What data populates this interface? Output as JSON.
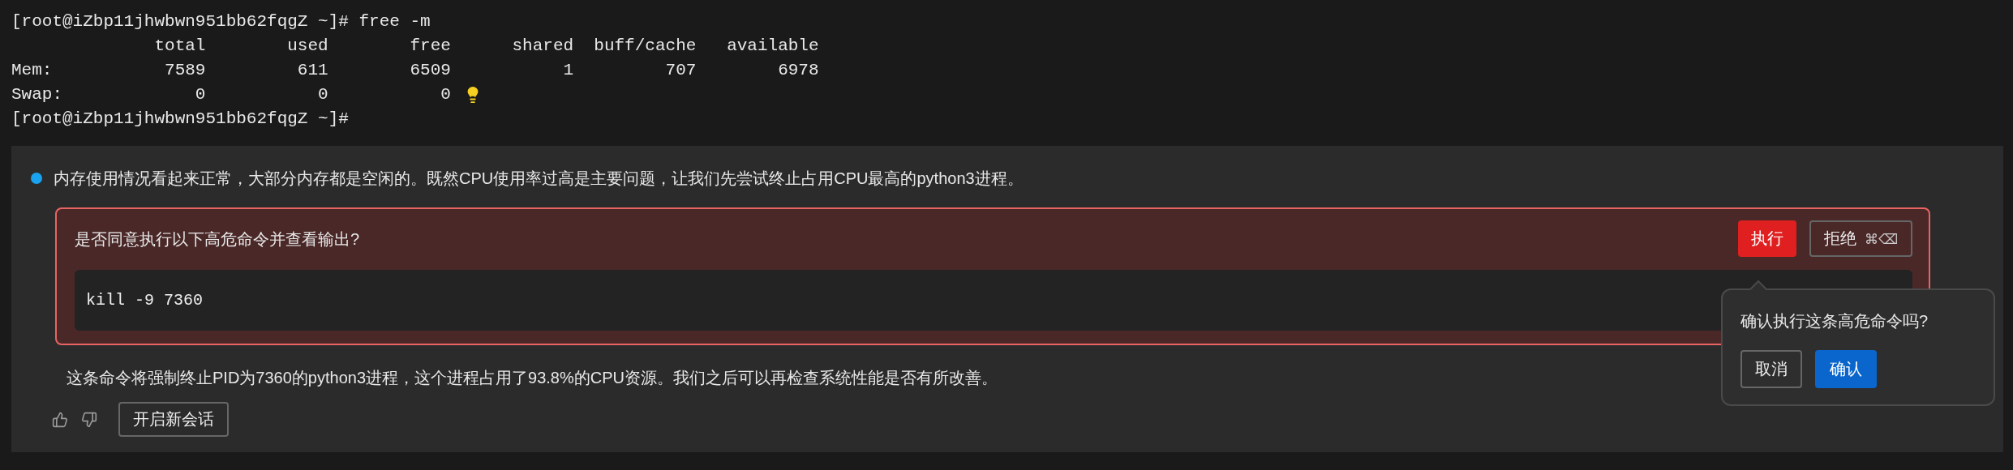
{
  "terminal": {
    "lines": [
      {
        "text": "[root@iZbp11jhwbwn951bb62fqgZ ~]# free -m",
        "hint": false
      },
      {
        "text": "              total        used        free      shared  buff/cache   available",
        "hint": false
      },
      {
        "text": "Mem:           7589         611        6509           1         707        6978",
        "hint": false
      },
      {
        "text": "Swap:             0           0           0",
        "hint": true
      },
      {
        "text": "[root@iZbp11jhwbwn951bb62fqgZ ~]#",
        "hint": false
      }
    ]
  },
  "assistant": {
    "message": "内存使用情况看起来正常，大部分内存都是空闲的。既然CPU使用率过高是主要问题，让我们先尝试终止占用CPU最高的python3进程。",
    "approval": {
      "question": "是否同意执行以下高危命令并查看输出?",
      "run_button": "执行",
      "reject_button": "拒绝",
      "reject_shortcut": "⌘⌫",
      "command": "kill -9 7360",
      "popover": {
        "text": "确认执行这条高危命令吗?",
        "cancel": "取消",
        "confirm": "确认"
      }
    },
    "explanation": "这条命令将强制终止PID为7360的python3进程，这个进程占用了93.8%的CPU资源。我们之后可以再检查系统性能是否有所改善。",
    "new_chat_button": "开启新会话"
  }
}
